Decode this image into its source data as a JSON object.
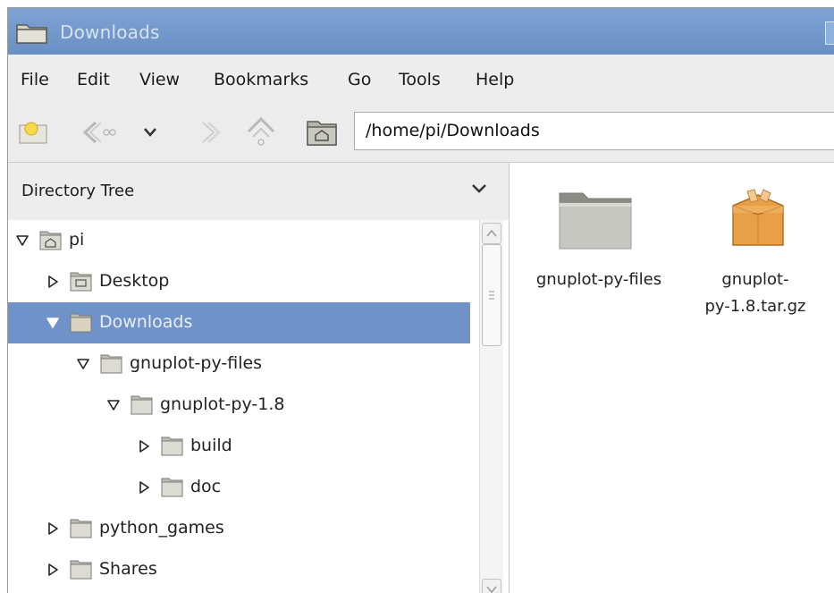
{
  "window": {
    "title": "Downloads"
  },
  "menubar": {
    "items": [
      "File",
      "Edit",
      "View",
      "Bookmarks",
      "Go",
      "Tools",
      "Help"
    ]
  },
  "toolbar": {
    "path": "/home/pi/Downloads",
    "icons": [
      "new-tab-icon",
      "back-icon",
      "history-dropdown-icon",
      "forward-icon",
      "up-icon",
      "home-icon"
    ]
  },
  "sidebar": {
    "header": "Directory Tree",
    "items": [
      {
        "label": "pi",
        "icon": "home-folder",
        "expanded": true
      },
      {
        "label": "Desktop",
        "icon": "desktop-folder",
        "expanded": false
      },
      {
        "label": "Downloads",
        "icon": "folder",
        "expanded": true,
        "selected": true
      },
      {
        "label": "gnuplot-py-files",
        "icon": "folder",
        "expanded": true
      },
      {
        "label": "gnuplot-py-1.8",
        "icon": "folder",
        "expanded": true
      },
      {
        "label": "build",
        "icon": "folder",
        "expanded": false
      },
      {
        "label": "doc",
        "icon": "folder",
        "expanded": false
      },
      {
        "label": "python_games",
        "icon": "folder",
        "expanded": false
      },
      {
        "label": "Shares",
        "icon": "folder",
        "expanded": false
      }
    ]
  },
  "files": [
    {
      "name": "gnuplot-py-files",
      "type": "folder"
    },
    {
      "name": "gnuplot-py-1.8.tar.gz",
      "type": "archive",
      "line1": "gnuplot-",
      "line2": "py-1.8.tar.gz"
    }
  ],
  "colors": {
    "titlebar": "#6f92c8",
    "selection": "#6f92c8",
    "folder": "#c8c8c2",
    "archive": "#e8a050"
  }
}
